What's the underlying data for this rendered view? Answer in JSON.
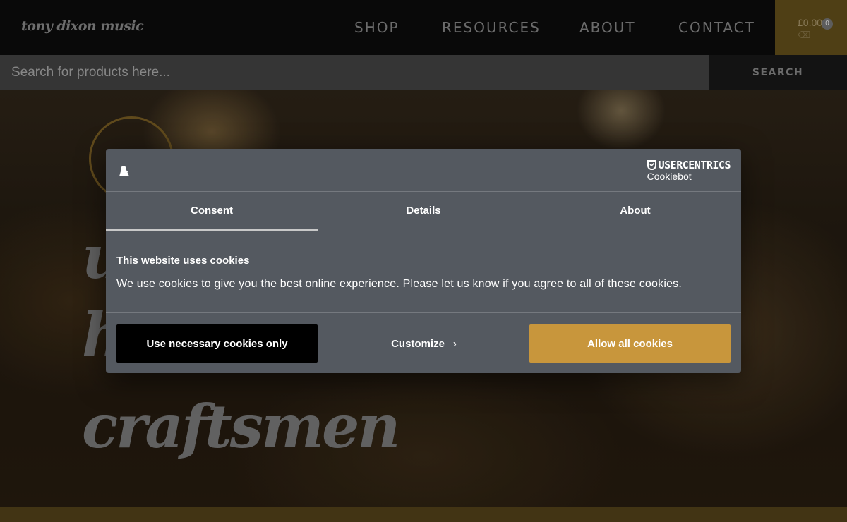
{
  "header": {
    "logo_text": "tony dixon music",
    "nav": [
      "SHOP",
      "RESOURCES",
      "ABOUT",
      "CONTACT"
    ],
    "cart": {
      "total": "£0.00",
      "count": "0"
    }
  },
  "search": {
    "placeholder": "Search for products here...",
    "button_label": "SEARCH"
  },
  "hero": {
    "words": [
      "u",
      "h",
      "craftsmen"
    ]
  },
  "cookie_dialog": {
    "brand_top": "USERCENTRICS",
    "brand_bottom": "Cookiebot",
    "tabs": [
      "Consent",
      "Details",
      "About"
    ],
    "active_tab": "Consent",
    "title": "This website uses cookies",
    "text": "We use cookies to give you the best online experience. Please let us know if you agree to all of these cookies.",
    "buttons": {
      "necessary": "Use necessary cookies only",
      "customize": "Customize",
      "allow": "Allow all cookies"
    }
  },
  "colors": {
    "accent": "#c8963c",
    "dialog_bg": "#545960",
    "header_bg": "#0b0b0b"
  }
}
